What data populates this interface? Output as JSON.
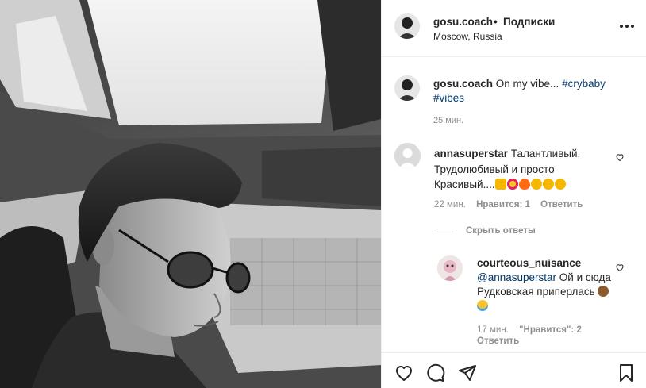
{
  "post": {
    "username": "gosu.coach",
    "separator": "•",
    "follow_label": "Подписки",
    "location": "Moscow, Russia"
  },
  "caption": {
    "username": "gosu.coach",
    "text": "On my vibe...",
    "hashtag_1": "#crybaby",
    "hashtag_2": "#vibes",
    "time": "25 мин."
  },
  "comments": [
    {
      "username": "annasuperstar",
      "text": "Талантливый, Трудолюбивый и просто Красивый....",
      "emoji_names": [
        "thumbs-up",
        "star-struck",
        "fire",
        "clapping-hands",
        "clapping-hands",
        "clapping-hands"
      ],
      "time": "22 мин.",
      "likes_label": "Нравится: 1",
      "reply_label": "Ответить",
      "hide_replies_label": "Скрыть ответы"
    },
    {
      "username": "courteous_nuisance",
      "mention": "@annasuperstar",
      "text": "Ой и сюда Рудковская приперлась",
      "emoji_names": [
        "see-no-evil-monkey",
        "tears-of-joy"
      ],
      "time": "17 мин.",
      "likes_label": "\"Нравится\": 2",
      "reply_label": "Ответить"
    }
  ],
  "actions": [
    "heart-icon",
    "comment-icon",
    "share-icon",
    "bookmark-icon"
  ],
  "colors": {
    "text": "#262626",
    "muted": "#8e8e8e",
    "link": "#00376b",
    "border": "#efefef"
  }
}
